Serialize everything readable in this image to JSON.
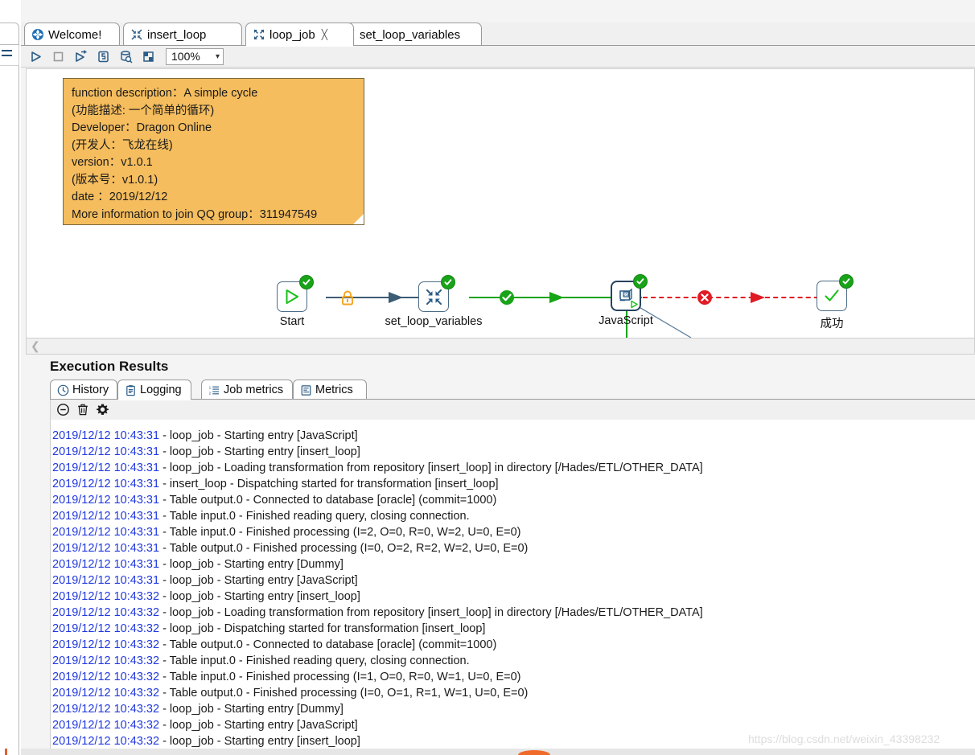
{
  "window": {
    "editor_tabs": [
      {
        "label": "Welcome!",
        "icon": "welcome-globe-icon",
        "active": false,
        "closable": false
      },
      {
        "label": "insert_loop",
        "icon": "transformation-icon",
        "active": false,
        "closable": false
      },
      {
        "label": "loop_job",
        "icon": "job-icon",
        "active": true,
        "closable": true,
        "close_glyph": "╳"
      },
      {
        "label": "set_loop_variables",
        "icon": "transformation-icon",
        "active": false,
        "closable": false
      }
    ]
  },
  "toolbar": {
    "buttons": [
      {
        "name": "run-button",
        "icon": "play-icon",
        "title": "Run"
      },
      {
        "name": "stop-button",
        "icon": "stop-square-icon",
        "title": "Stop"
      },
      {
        "name": "run-options-button",
        "icon": "play-arrow-icon",
        "title": "Run Options"
      },
      {
        "name": "sql-button",
        "icon": "script-icon",
        "title": "Show SQL"
      },
      {
        "name": "explore-db-button",
        "icon": "database-search-icon",
        "title": "Explore Database"
      },
      {
        "name": "image-button",
        "icon": "image-grid-icon",
        "title": "Canvas Image"
      }
    ],
    "zoom": {
      "value": "100%",
      "caret": "⌄"
    }
  },
  "note": {
    "lines": [
      "function description：A simple cycle",
      "(功能描述: 一个简单的循环)",
      "Developer：Dragon Online",
      "(开发人：飞龙在线)",
      "version：v1.0.1",
      "(版本号：v1.0.1)",
      "date ：2019/12/12",
      "More information to join QQ group：311947549"
    ],
    "background_color": "#f5bd5e"
  },
  "flow": {
    "nodes": [
      {
        "id": "start",
        "label": "Start",
        "icon": "start-play-icon",
        "status": "ok",
        "selected": false
      },
      {
        "id": "set_loop_variables",
        "label": "set_loop_variables",
        "icon": "transformation-icon",
        "status": "ok",
        "selected": false
      },
      {
        "id": "javascript",
        "label": "JavaScript",
        "icon": "javascript-icon",
        "status": "ok",
        "selected": true
      },
      {
        "id": "success",
        "label": "成功",
        "icon": "check-icon",
        "status": "ok",
        "selected": false
      }
    ],
    "hops": [
      {
        "from": "start",
        "to": "set_loop_variables",
        "kind": "unconditional",
        "badge": "lock-icon",
        "color": "#3c5c75"
      },
      {
        "from": "set_loop_variables",
        "to": "javascript",
        "kind": "success",
        "badge": "green-check-icon",
        "color": "#17a517"
      },
      {
        "from": "javascript",
        "to": "success",
        "kind": "failure",
        "badge": "red-error-icon",
        "color": "#e01b24"
      }
    ],
    "colors": {
      "ok": "#19a319",
      "error": "#e01b24",
      "lock": "#f5a623",
      "link": "#3c5c75",
      "green": "#17a517"
    }
  },
  "results": {
    "title": "Execution Results",
    "tabs": [
      {
        "label": "History",
        "icon": "clock-icon",
        "active": false
      },
      {
        "label": "Logging",
        "icon": "log-clipboard-icon",
        "active": true
      },
      {
        "label": "Job metrics",
        "icon": "ordered-list-icon",
        "active": false
      },
      {
        "label": "Metrics",
        "icon": "metrics-icon",
        "active": false
      }
    ],
    "log_toolbar": [
      {
        "name": "collapse-log-button",
        "icon": "minus-circle-icon"
      },
      {
        "name": "clear-log-button",
        "icon": "trash-icon"
      },
      {
        "name": "log-settings-button",
        "icon": "gear-icon"
      }
    ],
    "log_lines": [
      {
        "ts": "",
        "msg": "",
        "partial": true
      },
      {
        "ts": "2019/12/12 10:43:31",
        "msg": " - loop_job - Starting entry [JavaScript]"
      },
      {
        "ts": "2019/12/12 10:43:31",
        "msg": " - loop_job - Starting entry [insert_loop]"
      },
      {
        "ts": "2019/12/12 10:43:31",
        "msg": " - loop_job - Loading transformation from repository [insert_loop] in directory [/Hades/ETL/OTHER_DATA]"
      },
      {
        "ts": "2019/12/12 10:43:31",
        "msg": " - insert_loop - Dispatching started for transformation [insert_loop]"
      },
      {
        "ts": "2019/12/12 10:43:31",
        "msg": " - Table output.0 - Connected to database [oracle] (commit=1000)"
      },
      {
        "ts": "2019/12/12 10:43:31",
        "msg": " - Table input.0 - Finished reading query, closing connection."
      },
      {
        "ts": "2019/12/12 10:43:31",
        "msg": " - Table input.0 - Finished processing (I=2, O=0, R=0, W=2, U=0, E=0)"
      },
      {
        "ts": "2019/12/12 10:43:31",
        "msg": " - Table output.0 - Finished processing (I=0, O=2, R=2, W=2, U=0, E=0)"
      },
      {
        "ts": "2019/12/12 10:43:31",
        "msg": " - loop_job - Starting entry [Dummy]"
      },
      {
        "ts": "2019/12/12 10:43:31",
        "msg": " - loop_job - Starting entry [JavaScript]"
      },
      {
        "ts": "2019/12/12 10:43:32",
        "msg": " - loop_job - Starting entry [insert_loop]"
      },
      {
        "ts": "2019/12/12 10:43:32",
        "msg": " - loop_job - Loading transformation from repository [insert_loop] in directory [/Hades/ETL/OTHER_DATA]"
      },
      {
        "ts": "2019/12/12 10:43:32",
        "msg": " - loop_job - Dispatching started for transformation [insert_loop]"
      },
      {
        "ts": "2019/12/12 10:43:32",
        "msg": " - Table output.0 - Connected to database [oracle] (commit=1000)"
      },
      {
        "ts": "2019/12/12 10:43:32",
        "msg": " - Table input.0 - Finished reading query, closing connection."
      },
      {
        "ts": "2019/12/12 10:43:32",
        "msg": " - Table input.0 - Finished processing (I=1, O=0, R=0, W=1, U=0, E=0)"
      },
      {
        "ts": "2019/12/12 10:43:32",
        "msg": " - Table output.0 - Finished processing (I=0, O=1, R=1, W=1, U=0, E=0)"
      },
      {
        "ts": "2019/12/12 10:43:32",
        "msg": " - loop_job - Starting entry [Dummy]"
      },
      {
        "ts": "2019/12/12 10:43:32",
        "msg": " - loop_job - Starting entry [JavaScript]"
      },
      {
        "ts": "2019/12/12 10:43:32",
        "msg": " - loop_job - Starting entry [insert_loop]"
      }
    ]
  },
  "watermark": {
    "text": "https://blog.csdn.net/weixin_43398232"
  }
}
